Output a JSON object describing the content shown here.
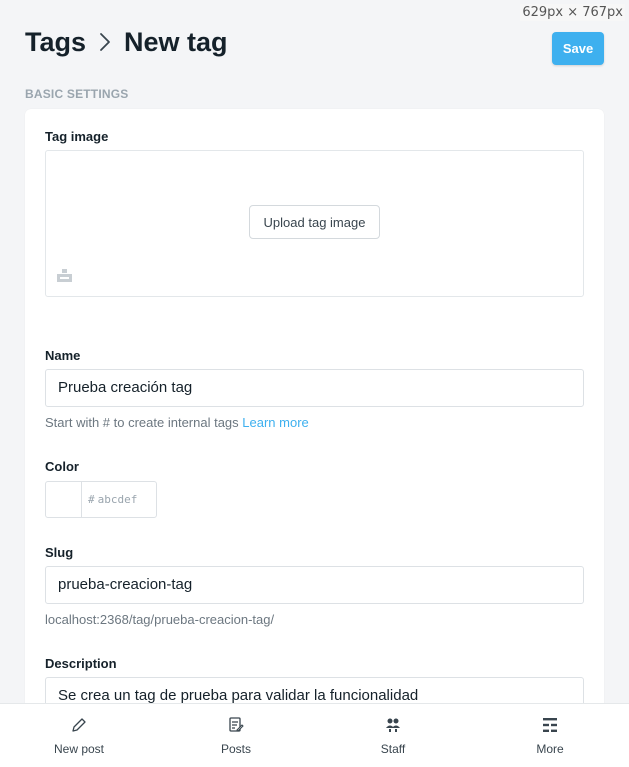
{
  "overlay": {
    "dimensions": "629px × 767px"
  },
  "header": {
    "breadcrumb_parent": "Tags",
    "breadcrumb_current": "New tag",
    "save_label": "Save"
  },
  "section": {
    "title": "BASIC SETTINGS"
  },
  "form": {
    "tag_image": {
      "label": "Tag image",
      "upload_label": "Upload tag image"
    },
    "name": {
      "label": "Name",
      "value": "Prueba creación tag",
      "hint": "Start with # to create internal tags",
      "hint_link": "Learn more"
    },
    "color": {
      "label": "Color",
      "hash": "#",
      "placeholder": "abcdef"
    },
    "slug": {
      "label": "Slug",
      "value": "prueba-creacion-tag",
      "url_preview": "localhost:2368/tag/prueba-creacion-tag/"
    },
    "description": {
      "label": "Description",
      "value": "Se crea un tag de prueba para validar la funcionalidad"
    }
  },
  "bottom_nav": {
    "items": [
      {
        "label": "New post",
        "icon": "pencil-icon"
      },
      {
        "label": "Posts",
        "icon": "posts-icon"
      },
      {
        "label": "Staff",
        "icon": "staff-icon"
      },
      {
        "label": "More",
        "icon": "more-icon"
      }
    ]
  },
  "colors": {
    "accent": "#3eb0ef",
    "text": "#15212a",
    "muted": "#9aa5ae"
  }
}
